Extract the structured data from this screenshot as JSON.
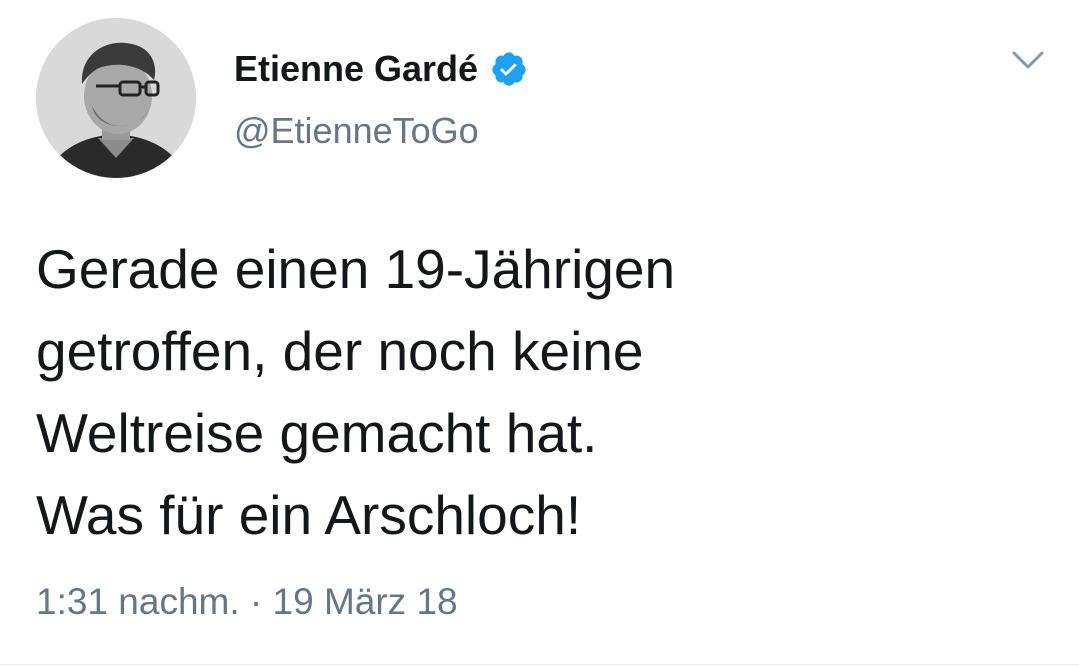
{
  "tweet": {
    "author": {
      "display_name": "Etienne Gardé",
      "handle": "@EtienneToGo",
      "verified": true,
      "avatar_icon": "user-photo-avatar"
    },
    "text_lines": [
      "Gerade einen 19-Jährigen",
      "getroffen, der noch keine",
      "Weltreise gemacht hat.",
      "Was für ein Arschloch!"
    ],
    "timestamp": "1:31 nachm. · 19 März 18",
    "menu_icon": "chevron-down-icon"
  },
  "colors": {
    "primary_text": "#14171a",
    "secondary_text": "#657786",
    "verified_badge": "#1da1f2",
    "divider": "#e6ecf0",
    "background": "#ffffff"
  }
}
